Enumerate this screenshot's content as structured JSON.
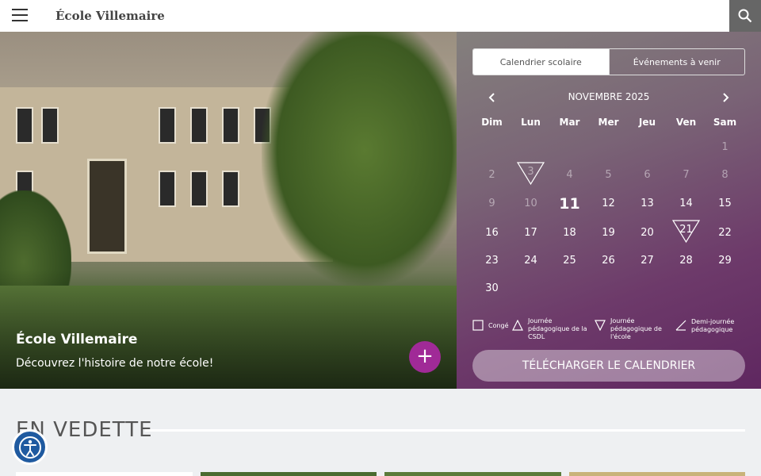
{
  "header": {
    "site_title": "École Villemaire",
    "menu_icon": "hamburger-icon",
    "search_icon": "search-icon"
  },
  "hero": {
    "title": "École Villemaire",
    "subtitle": "Découvrez l'histoire de notre école!",
    "more_label": "+"
  },
  "calendar": {
    "tabs": [
      "Calendrier scolaire",
      "Événements à venir"
    ],
    "active_tab": 0,
    "month_label": "NOVEMBRE 2025",
    "weekdays": [
      "Dim",
      "Lun",
      "Mar",
      "Mer",
      "Jeu",
      "Ven",
      "Sam"
    ],
    "weeks": [
      [
        "",
        "",
        "",
        "",
        "",
        "",
        "1"
      ],
      [
        "2",
        "3",
        "4",
        "5",
        "6",
        "7",
        "8"
      ],
      [
        "9",
        "10",
        "11",
        "12",
        "13",
        "14",
        "15"
      ],
      [
        "16",
        "17",
        "18",
        "19",
        "20",
        "21",
        "22"
      ],
      [
        "23",
        "24",
        "25",
        "26",
        "27",
        "28",
        "29"
      ],
      [
        "30",
        "",
        "",
        "",
        "",
        "",
        ""
      ]
    ],
    "today": "11",
    "dimmed_days": [
      "1",
      "2",
      "3",
      "4",
      "5",
      "6",
      "7",
      "8",
      "9",
      "10"
    ],
    "school_pedagogical_days": [
      "3",
      "21"
    ],
    "legend": {
      "conge": "Congé",
      "csdl": "Journée pédagogique de la CSDL",
      "ecole": "Journée pédagogique de l'école",
      "demi": "Demi-journée pédagogique"
    },
    "download_label": "TÉLÉCHARGER LE CALENDRIER"
  },
  "featured": {
    "title": "EN VEDETTE"
  },
  "accessibility_icon": "accessibility-icon",
  "colors": {
    "accent": "#a02a97",
    "calendar_bg": "#6d3a6a",
    "accessibility": "#1f5aa0"
  }
}
